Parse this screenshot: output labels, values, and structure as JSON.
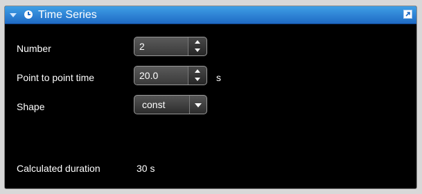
{
  "panel": {
    "title": "Time Series",
    "icons": {
      "collapse": "triangle-down-icon",
      "clock": "clock-icon",
      "expand": "external-window-icon"
    },
    "accent_color": "#2a7fd6"
  },
  "fields": {
    "number": {
      "label": "Number",
      "value": "2"
    },
    "point_to_point_time": {
      "label": "Point to point time",
      "value": "20.0",
      "unit": "s"
    },
    "shape": {
      "label": "Shape",
      "selected": "const"
    }
  },
  "calculated": {
    "label": "Calculated duration",
    "value": "30 s"
  }
}
